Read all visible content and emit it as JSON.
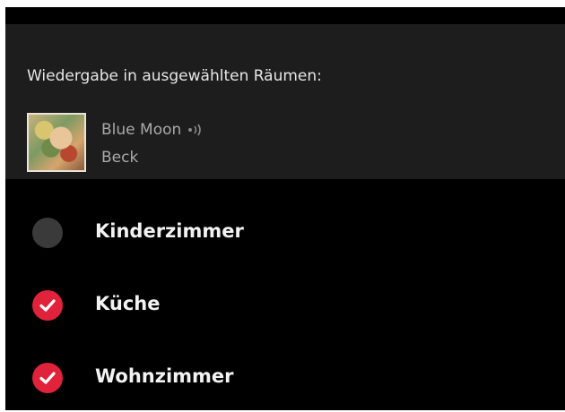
{
  "header": {
    "title": "Wiedergabe in ausgewählten Räumen:"
  },
  "now_playing": {
    "title": "Blue Moon",
    "artist": "Beck",
    "album_art": "album-cover-image",
    "playing_indicator": "speaker-icon"
  },
  "rooms": [
    {
      "label": "Kinderzimmer",
      "selected": false
    },
    {
      "label": "Küche",
      "selected": true
    },
    {
      "label": "Wohnzimmer",
      "selected": true
    }
  ],
  "colors": {
    "accent": "#e0223a",
    "unselected": "#3a3a3a",
    "panel": "#1d1d1d",
    "background": "#000000"
  }
}
